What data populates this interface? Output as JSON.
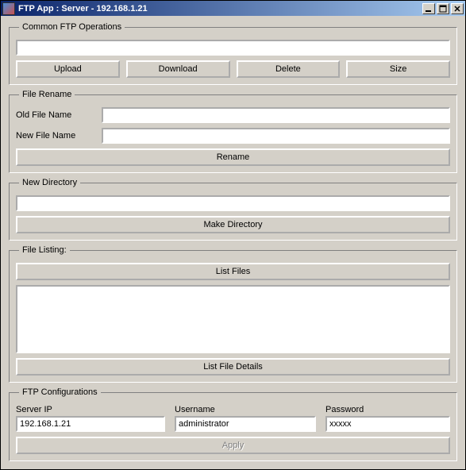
{
  "titlebar": {
    "title": "FTP App : Server - 192.168.1.21"
  },
  "common_ops": {
    "legend": "Common FTP Operations",
    "text_value": "",
    "upload_label": "Upload",
    "download_label": "Download",
    "delete_label": "Delete",
    "size_label": "Size"
  },
  "rename": {
    "legend": "File Rename",
    "old_label": "Old File Name",
    "new_label": "New File Name",
    "old_value": "",
    "new_value": "",
    "rename_label": "Rename"
  },
  "newdir": {
    "legend": "New Directory",
    "text_value": "",
    "make_label": "Make Directory"
  },
  "listing": {
    "legend": "File Listing:",
    "list_files_label": "List Files",
    "list_details_label": "List File Details"
  },
  "config": {
    "legend": "FTP Configurations",
    "server_ip_label": "Server IP",
    "server_ip_value": "192.168.1.21",
    "username_label": "Username",
    "username_value": "administrator",
    "password_label": "Password",
    "password_value": "xxxxx",
    "apply_label": "Apply"
  }
}
